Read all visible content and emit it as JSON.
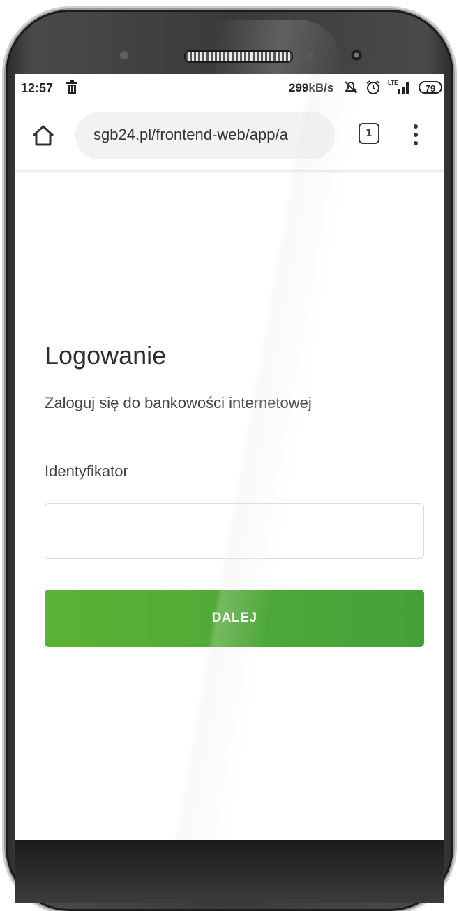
{
  "status_bar": {
    "time": "12:57",
    "network_speed": "299kB/s",
    "network_type": "LTE",
    "battery": "79"
  },
  "browser": {
    "url": "sgb24.pl/frontend-web/app/a",
    "tab_count": "1"
  },
  "login": {
    "title": "Logowanie",
    "subtitle": "Zaloguj się do bankowości internetowej",
    "identifier_label": "Identyfikator",
    "identifier_value": "",
    "identifier_placeholder": "",
    "next_button": "DALEJ"
  },
  "colors": {
    "button_start": "#5cb234",
    "button_end": "#44a13a"
  },
  "icons": {
    "status": [
      "trash-icon",
      "mute-icon",
      "alarm-icon",
      "signal-icon",
      "battery-icon"
    ],
    "browser": [
      "home-icon",
      "tabs-button",
      "menu-icon"
    ]
  }
}
